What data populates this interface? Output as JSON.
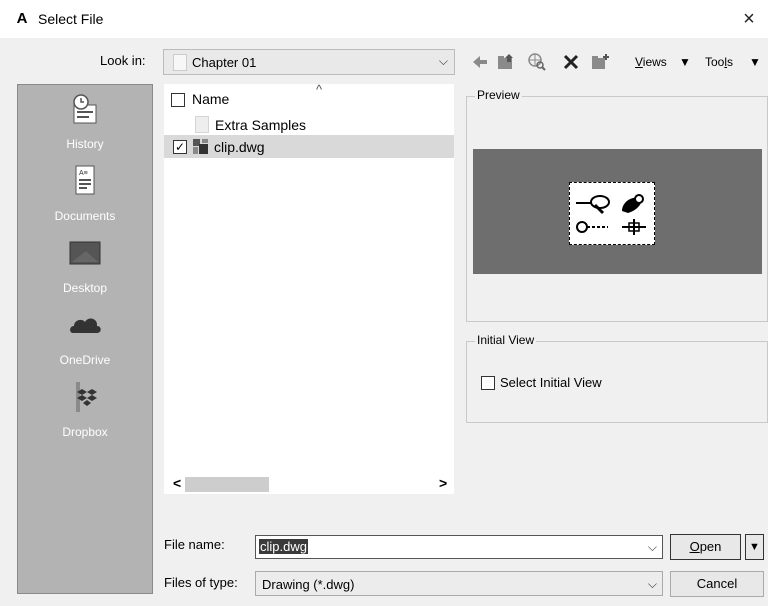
{
  "window": {
    "title": "Select File",
    "app_icon": "A",
    "close_glyph": "×"
  },
  "toolbar": {
    "look_in_label": "Look in:",
    "look_in_value": "Chapter 01",
    "back_icon": "back-arrow-icon",
    "up_icon": "up-folder-icon",
    "web_icon": "search-web-icon",
    "delete_icon": "delete-icon",
    "new_folder_icon": "new-folder-icon",
    "views_label": "Views",
    "tools_label": "Tools",
    "dropdown_glyph": "▼",
    "combo_arrow_glyph": "⌵"
  },
  "places": [
    {
      "label": "History",
      "icon": "history-icon"
    },
    {
      "label": "Documents",
      "icon": "documents-icon"
    },
    {
      "label": "Desktop",
      "icon": "desktop-icon"
    },
    {
      "label": "OneDrive",
      "icon": "onedrive-cloud-icon"
    },
    {
      "label": "Dropbox",
      "icon": "dropbox-icon"
    }
  ],
  "file_list": {
    "column_header": "Name",
    "sort_glyph": "^",
    "items": [
      {
        "name": "Extra Samples",
        "type": "folder",
        "selected": false
      },
      {
        "name": "clip.dwg",
        "type": "dwg-file",
        "selected": true,
        "checked": true
      }
    ],
    "scroll_left_glyph": "<",
    "scroll_right_glyph": ">"
  },
  "preview": {
    "legend": "Preview"
  },
  "initial_view": {
    "legend": "Initial View",
    "checkbox_label": "Select Initial View",
    "checked": false
  },
  "footer": {
    "file_name_label": "File name:",
    "file_name_value": "clip.dwg",
    "files_of_type_label": "Files of type:",
    "files_of_type_value": "Drawing (*.dwg)",
    "open_label": "Open",
    "cancel_label": "Cancel",
    "check_glyph": "✓"
  },
  "colors": {
    "places_bg": "#b3b3b3",
    "preview_bg": "#6e6e6e",
    "selection_bg": "#d9d9d9"
  }
}
